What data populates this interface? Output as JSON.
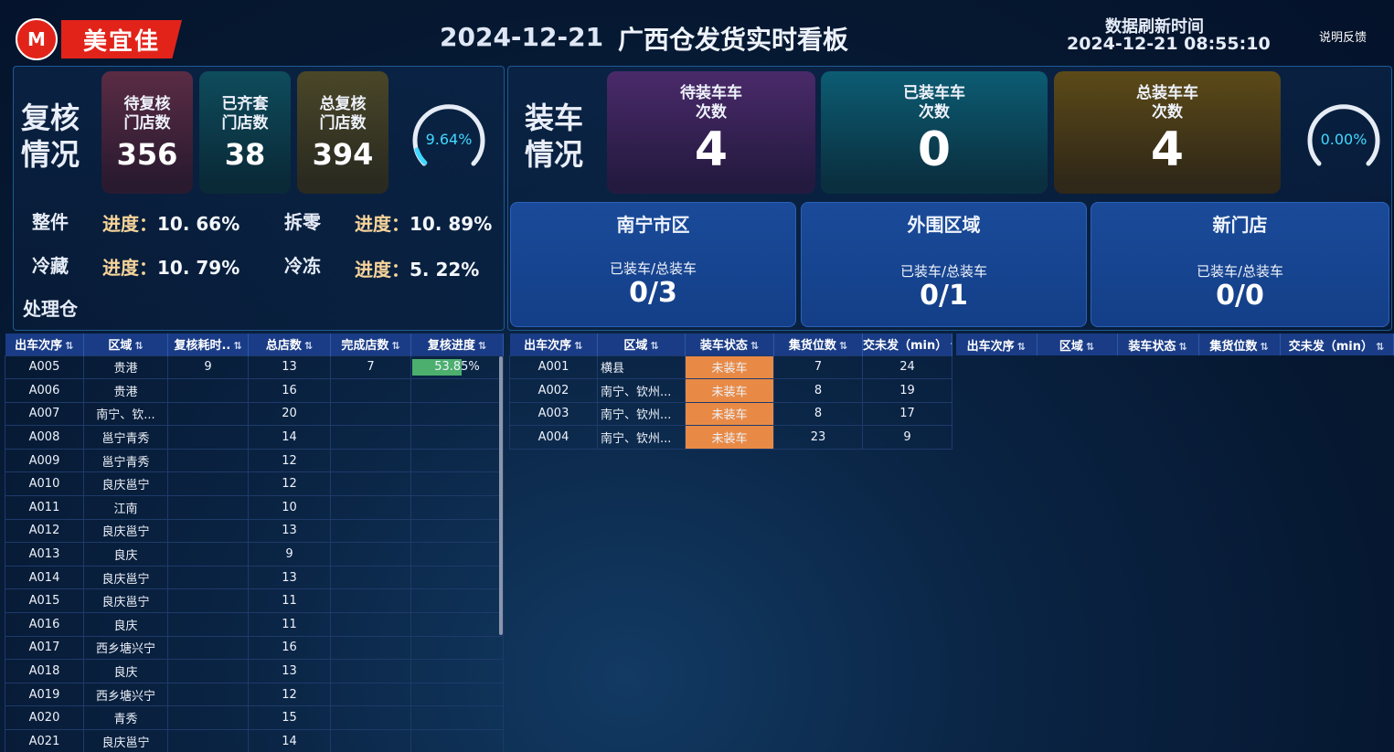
{
  "header": {
    "logo_text": "M",
    "brand": "美宜佳",
    "date": "2024-12-21",
    "title": "广西仓发货实时看板",
    "refresh_label": "数据刷新时间",
    "refresh_time": "2024-12-21 08:55:10",
    "feedback": "说明反馈"
  },
  "recheck": {
    "title": "复核情况",
    "cards": [
      {
        "label": "待复核门店数",
        "value": "356",
        "color": "#5a2c44"
      },
      {
        "label": "已齐套门店数",
        "value": "38",
        "color": "#0e4c5c"
      },
      {
        "label": "总复核门店数",
        "value": "394",
        "color": "#4a4728"
      }
    ],
    "gauge_label": "9.64%",
    "gauge_value": 0.0964,
    "progress": [
      {
        "name": "整件",
        "label": "进度：",
        "value": "10. 66%"
      },
      {
        "name": "拆零",
        "label": "进度：",
        "value": "10. 89%"
      },
      {
        "name": "冷藏",
        "label": "进度：",
        "value": "10. 79%"
      },
      {
        "name": "冷冻",
        "label": "进度：",
        "value": "5. 22%"
      }
    ],
    "warehouse_label": "处理仓"
  },
  "loading": {
    "title": "装车情况",
    "cards": [
      {
        "label": "待装车车次数",
        "value": "4",
        "color": "#4a2a6a"
      },
      {
        "label": "已装车车次数",
        "value": "0",
        "color": "#0c5c73"
      },
      {
        "label": "总装车车次数",
        "value": "4",
        "color": "#5c4a18"
      }
    ],
    "gauge_label": "0.00%",
    "gauge_value": 0.0,
    "regions": [
      {
        "name": "南宁市区",
        "sub": "已装车/总装车",
        "value": "0/3"
      },
      {
        "name": "外围区域",
        "sub": "已装车/总装车",
        "value": "0/1"
      },
      {
        "name": "新门店",
        "sub": "已装车/总装车",
        "value": "0/0"
      }
    ]
  },
  "table_left": {
    "headers": [
      "出车次序",
      "区域",
      "复核耗时..",
      "总店数",
      "完成店数",
      "复核进度"
    ],
    "sort_icon": "⇅",
    "rows": [
      [
        "A005",
        "贵港",
        "9",
        "13",
        "7",
        "53.85%"
      ],
      [
        "A006",
        "贵港",
        "",
        "16",
        "",
        ""
      ],
      [
        "A007",
        "南宁、钦...",
        "",
        "20",
        "",
        ""
      ],
      [
        "A008",
        "邕宁青秀",
        "",
        "14",
        "",
        ""
      ],
      [
        "A009",
        "邕宁青秀",
        "",
        "12",
        "",
        ""
      ],
      [
        "A010",
        "良庆邕宁",
        "",
        "12",
        "",
        ""
      ],
      [
        "A011",
        "江南",
        "",
        "10",
        "",
        ""
      ],
      [
        "A012",
        "良庆邕宁",
        "",
        "13",
        "",
        ""
      ],
      [
        "A013",
        "良庆",
        "",
        "9",
        "",
        ""
      ],
      [
        "A014",
        "良庆邕宁",
        "",
        "13",
        "",
        ""
      ],
      [
        "A015",
        "良庆邕宁",
        "",
        "11",
        "",
        ""
      ],
      [
        "A016",
        "良庆",
        "",
        "11",
        "",
        ""
      ],
      [
        "A017",
        "西乡塘兴宁",
        "",
        "16",
        "",
        ""
      ],
      [
        "A018",
        "良庆",
        "",
        "13",
        "",
        ""
      ],
      [
        "A019",
        "西乡塘兴宁",
        "",
        "12",
        "",
        ""
      ],
      [
        "A020",
        "青秀",
        "",
        "15",
        "",
        ""
      ],
      [
        "A021",
        "良庆邕宁",
        "",
        "14",
        "",
        ""
      ]
    ],
    "progress_fill": 0.5385
  },
  "table_mid": {
    "headers": [
      "出车次序",
      "区域",
      "装车状态",
      "集货位数",
      "交未发（min）"
    ],
    "rows": [
      [
        "A001",
        "横县",
        "未装车",
        "7",
        "24"
      ],
      [
        "A002",
        "南宁、钦州...",
        "未装车",
        "8",
        "19"
      ],
      [
        "A003",
        "南宁、钦州...",
        "未装车",
        "8",
        "17"
      ],
      [
        "A004",
        "南宁、钦州...",
        "未装车",
        "23",
        "9"
      ]
    ]
  },
  "table_right": {
    "headers": [
      "出车次序",
      "区域",
      "装车状态",
      "集货位数",
      "交未发（min）"
    ]
  },
  "colors": {
    "accent_cyan": "#41d8ff",
    "status_orange": "#e88a46",
    "progress_green": "#4caf6e",
    "header_blue": "#1a3c86"
  }
}
